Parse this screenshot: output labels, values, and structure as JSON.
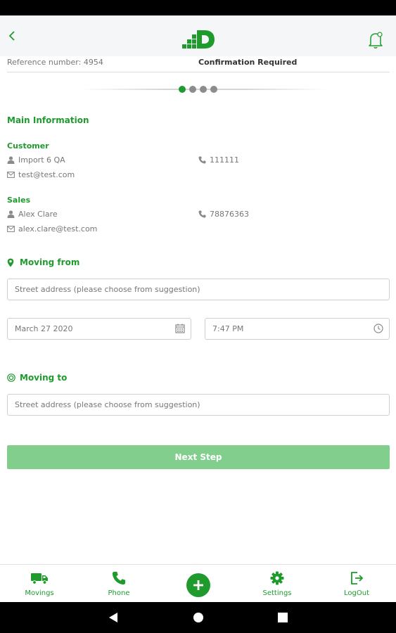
{
  "reference": {
    "label": "Reference number:",
    "number": "4954",
    "status": "Confirmation Required"
  },
  "stepper": {
    "steps": 4,
    "current": 1
  },
  "main_information": {
    "title": "Main Information"
  },
  "customer": {
    "title": "Customer",
    "name": "Import 6 QA",
    "phone": "111111",
    "email": "test@test.com"
  },
  "sales": {
    "title": "Sales",
    "name": "Alex Clare",
    "phone": "78876363",
    "email": "alex.clare@test.com"
  },
  "moving_from": {
    "title": "Moving from",
    "address_placeholder": "Street address (please choose from suggestion)",
    "date": "March 27 2020",
    "time": "7:47 PM"
  },
  "moving_to": {
    "title": "Moving to",
    "address_placeholder": "Street address (please choose from suggestion)"
  },
  "next_button": "Next Step",
  "nav": {
    "movings": "Movings",
    "phone": "Phone",
    "settings": "Settings",
    "logout": "LogOut"
  },
  "colors": {
    "brand": "#1f9b2e",
    "button_disabled": "#82cf8d"
  }
}
